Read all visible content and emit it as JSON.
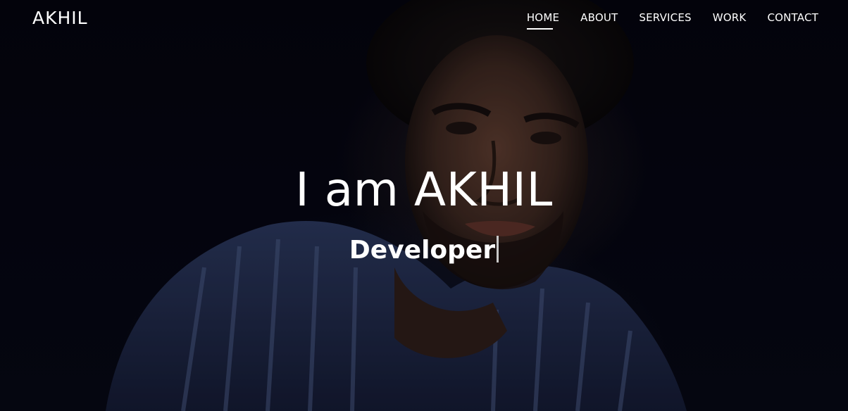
{
  "brand": "AKHIL",
  "nav": {
    "items": [
      {
        "label": "HOME",
        "active": true
      },
      {
        "label": "ABOUT",
        "active": false
      },
      {
        "label": "SERVICES",
        "active": false
      },
      {
        "label": "WORK",
        "active": false
      },
      {
        "label": "CONTACT",
        "active": false
      }
    ]
  },
  "hero": {
    "headline": "I am AKHIL",
    "role": "Developer",
    "background": "portrait-photo"
  },
  "colors": {
    "background": "#05060f",
    "text": "#ffffff",
    "shirt": "#1f2a48",
    "cursor": "#c8c8c8"
  }
}
